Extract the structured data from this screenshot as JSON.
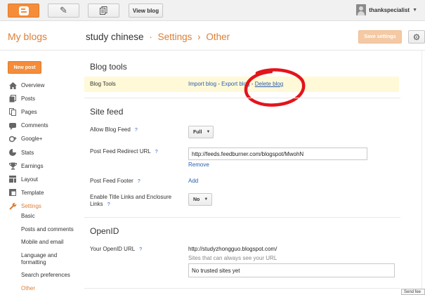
{
  "topbar": {
    "view_blog": "View blog",
    "username": "thankspecialist"
  },
  "header": {
    "my_blogs": "My blogs",
    "blog_name": "study chinese",
    "sep1": "·",
    "settings": "Settings",
    "sep2": "›",
    "current": "Other",
    "save_button": "Save settings"
  },
  "sidebar": {
    "new_post": "New post",
    "items": [
      {
        "label": "Overview",
        "icon": "home-icon"
      },
      {
        "label": "Posts",
        "icon": "posts-icon"
      },
      {
        "label": "Pages",
        "icon": "pages-icon"
      },
      {
        "label": "Comments",
        "icon": "comments-icon"
      },
      {
        "label": "Google+",
        "icon": "googleplus-icon"
      },
      {
        "label": "Stats",
        "icon": "stats-icon"
      },
      {
        "label": "Earnings",
        "icon": "trophy-icon"
      },
      {
        "label": "Layout",
        "icon": "layout-icon"
      },
      {
        "label": "Template",
        "icon": "template-icon"
      },
      {
        "label": "Settings",
        "icon": "wrench-icon",
        "active": true
      }
    ],
    "sub_items": [
      {
        "label": "Basic"
      },
      {
        "label": "Posts and comments"
      },
      {
        "label": "Mobile and email"
      },
      {
        "label": "Language and formatting"
      },
      {
        "label": "Search preferences"
      },
      {
        "label": "Other",
        "active": true
      }
    ]
  },
  "blog_tools": {
    "title": "Blog tools",
    "row_label": "Blog Tools",
    "import": "Import blog",
    "dash1": " - ",
    "export": "Export blog",
    "dash2": " - ",
    "delete": "Delete blog"
  },
  "site_feed": {
    "title": "Site feed",
    "allow_label": "Allow Blog Feed",
    "allow_value": "Full",
    "redirect_label": "Post Feed Redirect URL",
    "redirect_value": "http://feeds.feedburner.com/blogspot/MwohN",
    "remove": "Remove",
    "footer_label": "Post Feed Footer",
    "footer_add": "Add",
    "enclosure_label": "Enable Title Links and Enclosure Links",
    "enclosure_value": "No",
    "help": "?"
  },
  "openid": {
    "title": "OpenID",
    "url_label": "Your OpenID URL",
    "url_value": "http://studyzhongguo.blogspot.com/",
    "trusted_hint": "Sites that can always see your URL",
    "trusted_value": "No trusted sites yet"
  },
  "corner_tab": "Send fee",
  "colors": {
    "accent": "#dd7e34",
    "link": "#2a5db0",
    "annotation": "#e4141b"
  }
}
